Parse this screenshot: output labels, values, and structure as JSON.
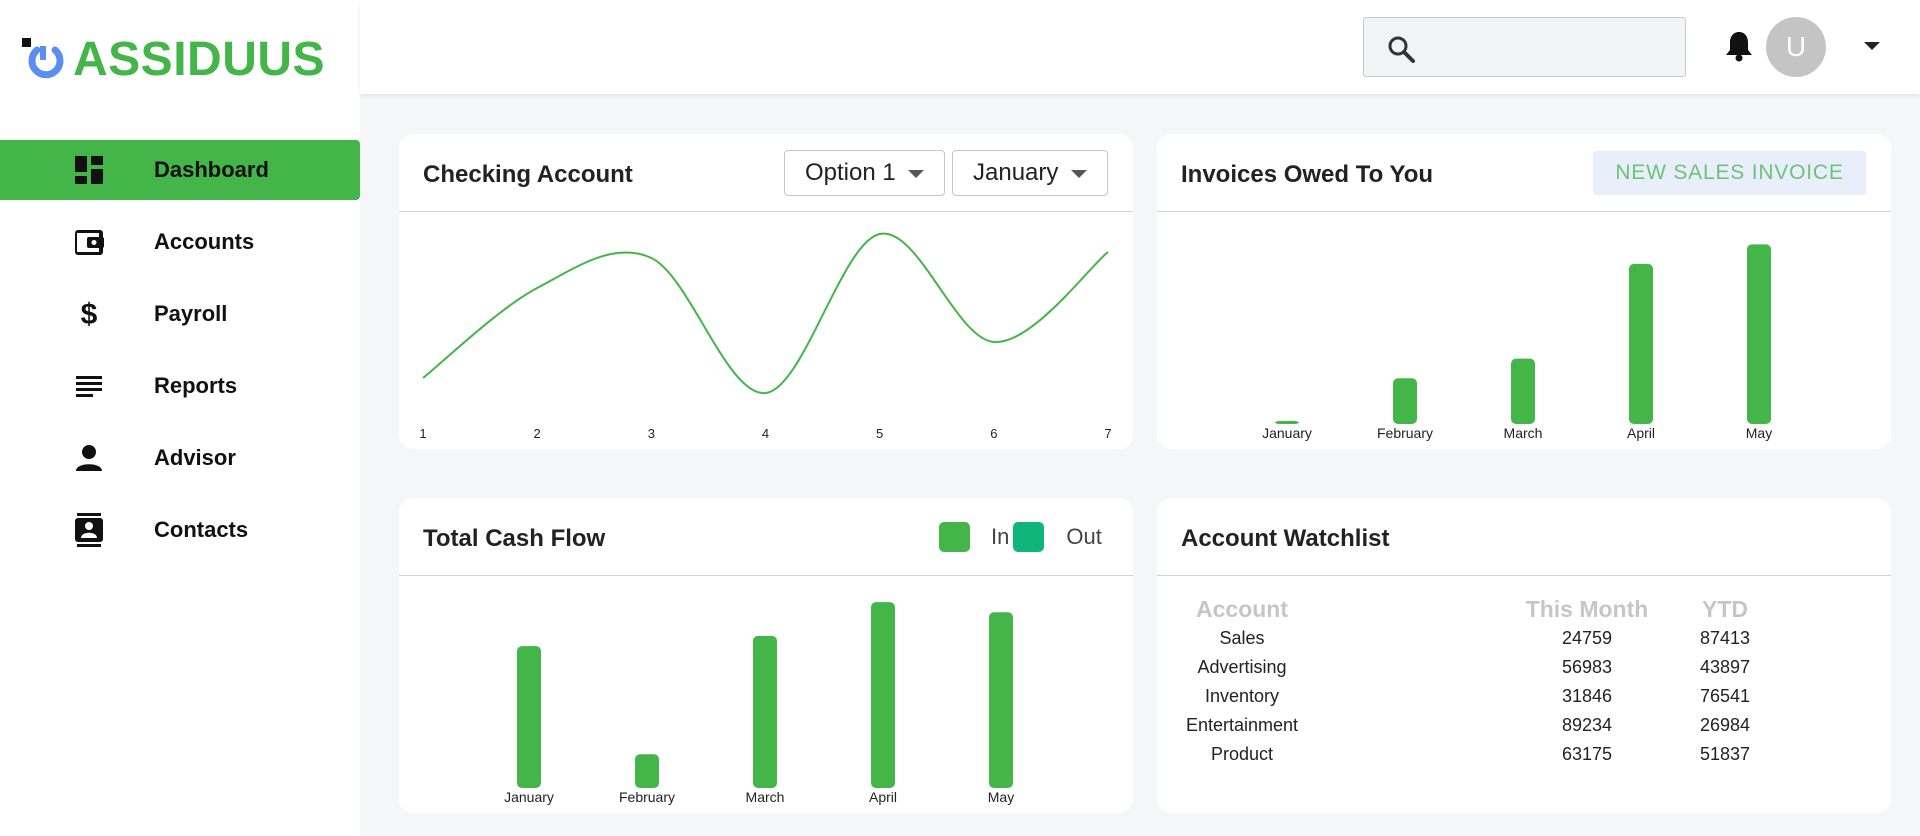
{
  "brand": {
    "name": "ASSIDUUS",
    "accent": "#44b549",
    "logo_blue": "#5a8ef0"
  },
  "sidebar": {
    "items": [
      {
        "label": "Dashboard",
        "icon": "dashboard-icon",
        "active": true
      },
      {
        "label": "Accounts",
        "icon": "wallet-icon",
        "active": false
      },
      {
        "label": "Payroll",
        "icon": "dollar-icon",
        "active": false
      },
      {
        "label": "Reports",
        "icon": "list-icon",
        "active": false
      },
      {
        "label": "Advisor",
        "icon": "person-icon",
        "active": false
      },
      {
        "label": "Contacts",
        "icon": "contact-card-icon",
        "active": false
      }
    ]
  },
  "topbar": {
    "search": {
      "value": "",
      "placeholder": ""
    },
    "avatar_initial": "U"
  },
  "checking": {
    "title": "Checking Account",
    "option_select": "Option 1",
    "month_select": "January"
  },
  "invoices": {
    "title": "Invoices Owed To You",
    "button": "NEW SALES INVOICE"
  },
  "cashflow": {
    "title": "Total Cash Flow",
    "legend_in": "In",
    "legend_out": "Out",
    "in_color": "#44b549",
    "out_color": "#0fb57b"
  },
  "watchlist": {
    "title": "Account Watchlist",
    "headers": [
      "Account",
      "This Month",
      "YTD"
    ],
    "rows": [
      [
        "Sales",
        "24759",
        "87413"
      ],
      [
        "Advertising",
        "56983",
        "43897"
      ],
      [
        "Inventory",
        "31846",
        "76541"
      ],
      [
        "Entertainment",
        "89234",
        "26984"
      ],
      [
        "Product",
        "63175",
        "51837"
      ]
    ]
  },
  "chart_data": [
    {
      "type": "line",
      "x": [
        1,
        2,
        3,
        4,
        5,
        6,
        7
      ],
      "values": [
        0,
        3,
        4,
        -0.5,
        4.8,
        1.2,
        4.2
      ],
      "ylim": [
        -1,
        5
      ],
      "title": "",
      "xlabel": "",
      "ylabel": ""
    },
    {
      "type": "bar",
      "categories": [
        "January",
        "February",
        "March",
        "April",
        "May"
      ],
      "values": [
        0.3,
        14,
        20,
        49,
        55
      ],
      "ylim": [
        0,
        60
      ],
      "title": "",
      "xlabel": "",
      "ylabel": ""
    },
    {
      "type": "bar",
      "categories": [
        "January",
        "February",
        "March",
        "April",
        "May"
      ],
      "series": [
        {
          "name": "In",
          "values": [
            42,
            10,
            45,
            55,
            52
          ]
        }
      ],
      "ylim": [
        0,
        58
      ],
      "title": "",
      "xlabel": "",
      "ylabel": ""
    }
  ]
}
